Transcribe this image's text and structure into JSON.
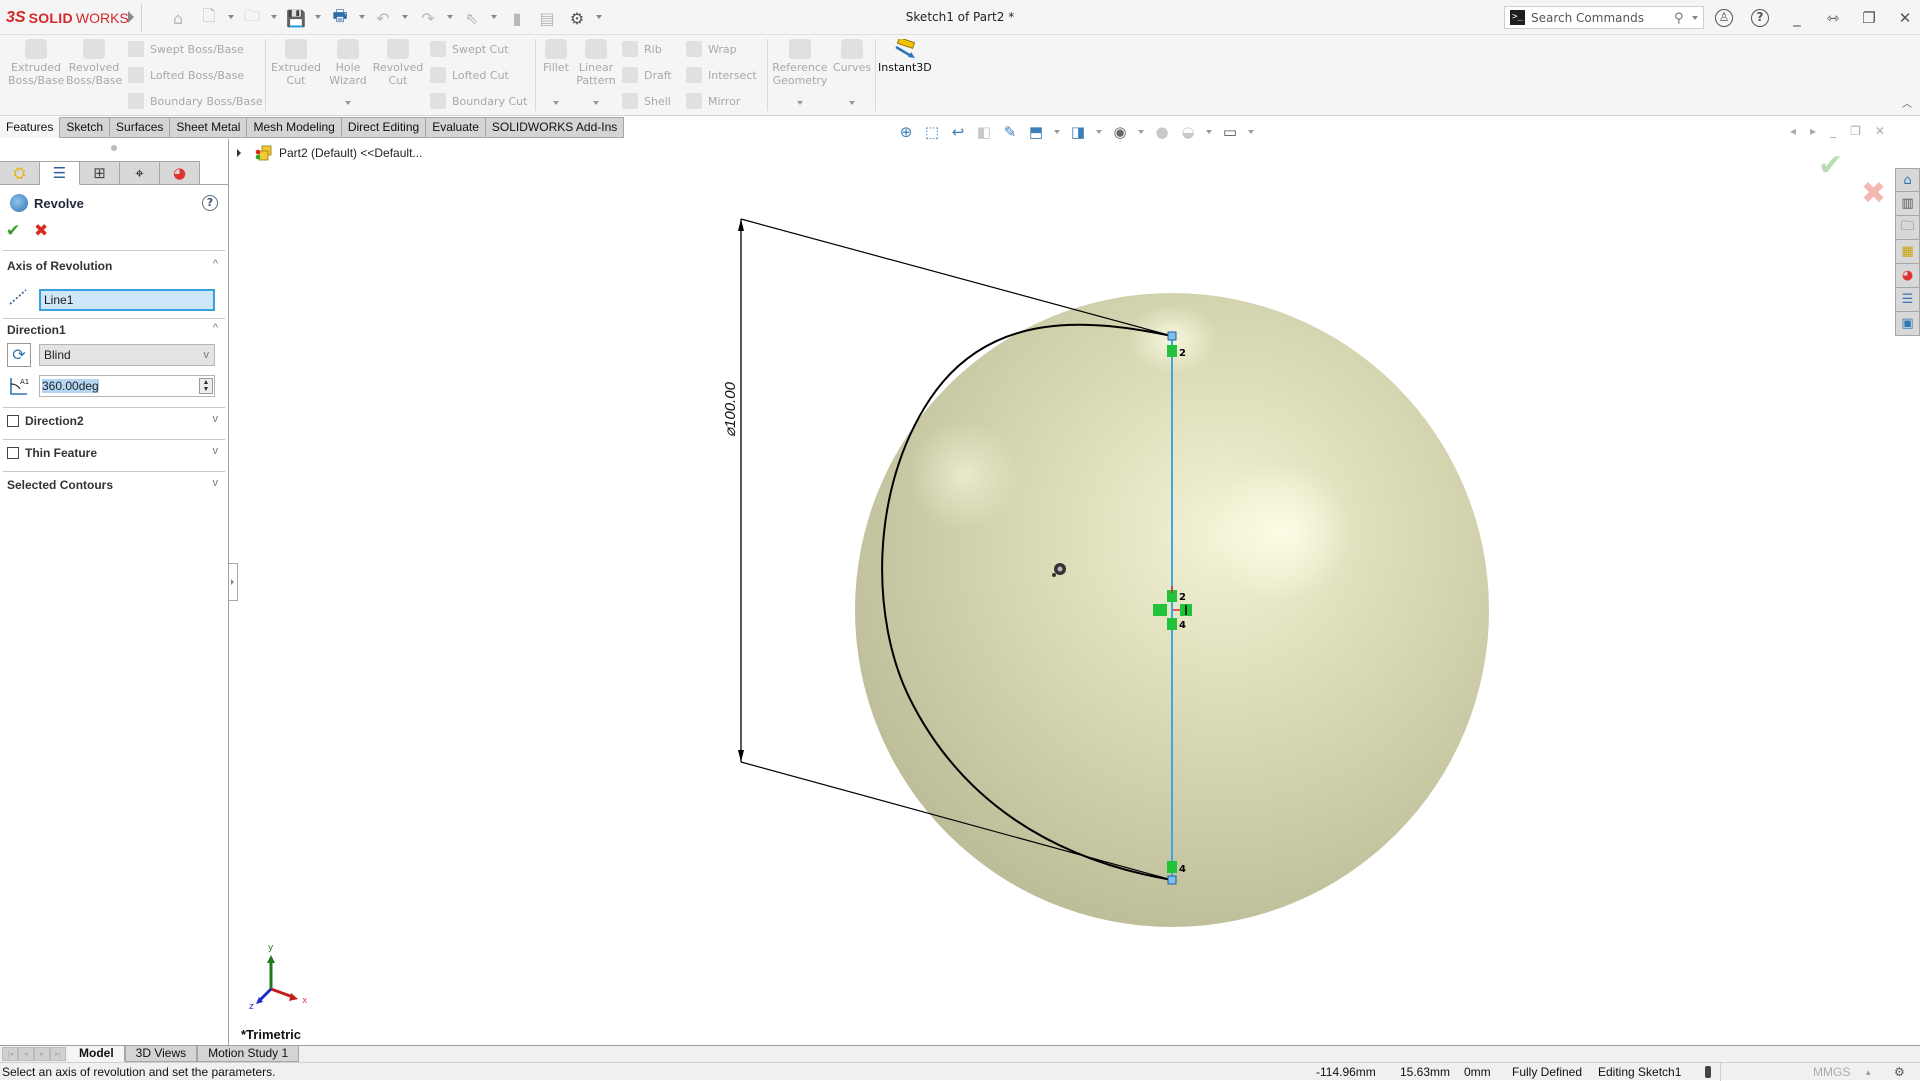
{
  "app": {
    "brand_prefix": "3S",
    "brand_bold": "SOLID",
    "brand_light": "WORKS",
    "title": "Sketch1 of Part2 *"
  },
  "quick_access": [
    {
      "icon": "home-icon",
      "glyph": "⌂"
    },
    {
      "icon": "new-document-icon",
      "glyph": "🗋"
    },
    {
      "icon": "open-folder-icon",
      "glyph": "🗀"
    },
    {
      "icon": "save-icon",
      "glyph": "💾"
    },
    {
      "icon": "print-icon",
      "glyph": "🖶"
    },
    {
      "icon": "undo-icon",
      "glyph": "↶"
    },
    {
      "icon": "redo-icon",
      "glyph": "↷"
    },
    {
      "icon": "select-icon",
      "glyph": "⇖"
    },
    {
      "icon": "rebuild-icon",
      "glyph": "▮"
    },
    {
      "icon": "file-properties-icon",
      "glyph": "▤"
    },
    {
      "icon": "options-icon",
      "glyph": "⚙"
    }
  ],
  "search": {
    "placeholder": "Search Commands",
    "prompt_glyph": ">_",
    "mag_glyph": "⚲"
  },
  "window_icons": {
    "user": "♙",
    "help": "?",
    "minimize": "_",
    "tile": "⇿",
    "restore": "❐",
    "close": "✕"
  },
  "command_manager": {
    "features": {
      "extruded_boss": "Extruded\nBoss/Base",
      "revolved_boss": "Revolved\nBoss/Base",
      "swept_boss": "Swept Boss/Base",
      "lofted_boss": "Lofted Boss/Base",
      "boundary_boss": "Boundary Boss/Base",
      "extruded_cut": "Extruded\nCut",
      "hole_wizard": "Hole\nWizard",
      "revolved_cut": "Revolved\nCut",
      "swept_cut": "Swept Cut",
      "lofted_cut": "Lofted Cut",
      "boundary_cut": "Boundary Cut",
      "fillet": "Fillet",
      "linear_pattern": "Linear\nPattern",
      "rib": "Rib",
      "draft": "Draft",
      "shell": "Shell",
      "wrap": "Wrap",
      "intersect": "Intersect",
      "mirror": "Mirror",
      "reference_geometry": "Reference\nGeometry",
      "curves": "Curves",
      "instant3d": "Instant3D"
    },
    "tabs": [
      "Features",
      "Sketch",
      "Surfaces",
      "Sheet Metal",
      "Mesh Modeling",
      "Direct Editing",
      "Evaluate",
      "SOLIDWORKS Add-Ins"
    ],
    "active_tab": "Features"
  },
  "heads_up_toolbar": [
    {
      "icon": "zoom-to-fit-icon",
      "glyph": "⊕"
    },
    {
      "icon": "zoom-to-area-icon",
      "glyph": "⬚"
    },
    {
      "icon": "previous-view-icon",
      "glyph": "↩"
    },
    {
      "icon": "section-view-icon",
      "glyph": "◧"
    },
    {
      "icon": "dynamic-annotation-icon",
      "glyph": "✎"
    },
    {
      "icon": "view-orientation-icon",
      "glyph": "⬒"
    },
    {
      "icon": "display-style-icon",
      "glyph": "◨"
    },
    {
      "icon": "hide-show-items-icon",
      "glyph": "◉"
    },
    {
      "icon": "edit-appearance-icon",
      "glyph": "●"
    },
    {
      "icon": "apply-scene-icon",
      "glyph": "◒"
    },
    {
      "icon": "view-settings-icon",
      "glyph": "▭"
    }
  ],
  "panel_tabs": [
    {
      "icon": "featuremanager-icon",
      "glyph": "⛭"
    },
    {
      "icon": "propertymanager-icon",
      "glyph": "☰"
    },
    {
      "icon": "configurationmanager-icon",
      "glyph": "⊞"
    },
    {
      "icon": "dimxpertmanager-icon",
      "glyph": "⌖"
    },
    {
      "icon": "displaymanager-icon",
      "glyph": "◕"
    }
  ],
  "property_manager": {
    "title": "Revolve",
    "help": "?",
    "ok_glyph": "✔",
    "cancel_glyph": "✖",
    "axis_section": "Axis of Revolution",
    "axis_value": "Line1",
    "direction1_section": "Direction1",
    "end_condition": "Blind",
    "angle_value": "360.00deg",
    "angle_icon_label": "A1",
    "direction2_section": "Direction2",
    "direction2_checked": false,
    "thin_feature_section": "Thin Feature",
    "thin_feature_checked": false,
    "selected_contours_section": "Selected Contours",
    "chev_up": "^",
    "chev_down": "v"
  },
  "feature_tree": {
    "root": "Part2 (Default) <<Default..."
  },
  "viewport": {
    "dimension_label": "⌀100.00",
    "relation_top": "2",
    "relation_center_top": "2",
    "relation_center_bottom": "4",
    "relation_bottom": "4",
    "view_name": "*Trimetric",
    "triad": {
      "x": "x",
      "y": "y",
      "z": "z"
    },
    "confirm_ok": "✔",
    "confirm_cancel": "✖",
    "part_color": "#d9d9b4",
    "axis_color": "#39a9e6"
  },
  "viewport_controls": [
    "◂",
    "▸",
    "_",
    "❐",
    "✕"
  ],
  "task_pane": [
    {
      "icon": "solidworks-resources-icon",
      "glyph": "⌂"
    },
    {
      "icon": "design-library-icon",
      "glyph": "▥"
    },
    {
      "icon": "file-explorer-icon",
      "glyph": "🗀"
    },
    {
      "icon": "view-palette-icon",
      "glyph": "▦"
    },
    {
      "icon": "appearances-icon",
      "glyph": "◕"
    },
    {
      "icon": "custom-properties-icon",
      "glyph": "☰"
    },
    {
      "icon": "solidworks-forum-icon",
      "glyph": "▣"
    }
  ],
  "bottom_tabs": [
    "Model",
    "3D Views",
    "Motion Study 1"
  ],
  "bottom_active": "Model",
  "nav_buttons": [
    "|◂",
    "◂",
    "▸",
    "▸|"
  ],
  "status": {
    "message": "Select an axis of revolution and set the parameters.",
    "x": "-114.96mm",
    "y": "15.63mm",
    "z": "0mm",
    "sketch_state": "Fully Defined",
    "editing": "Editing Sketch1",
    "units": "MMGS",
    "units_arrow": "▴"
  }
}
